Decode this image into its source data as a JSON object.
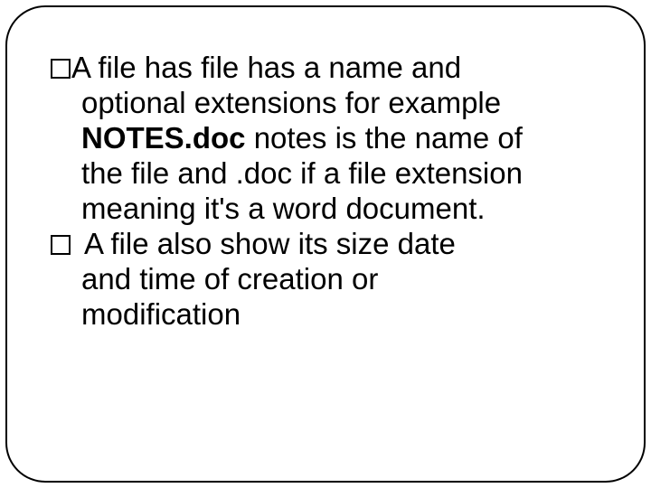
{
  "slide": {
    "item1": {
      "part1a": "A file has file has a name and",
      "part1b": "optional extensions for example",
      "part2a": "NOTES.doc",
      "part2b": " notes is the name of",
      "part2c": "the file and .doc if a file extension",
      "part2d": "meaning it's a word document."
    },
    "item2": {
      "part1": "A file also show its size date",
      "part2": "and time of creation or",
      "part3": "modification"
    }
  }
}
